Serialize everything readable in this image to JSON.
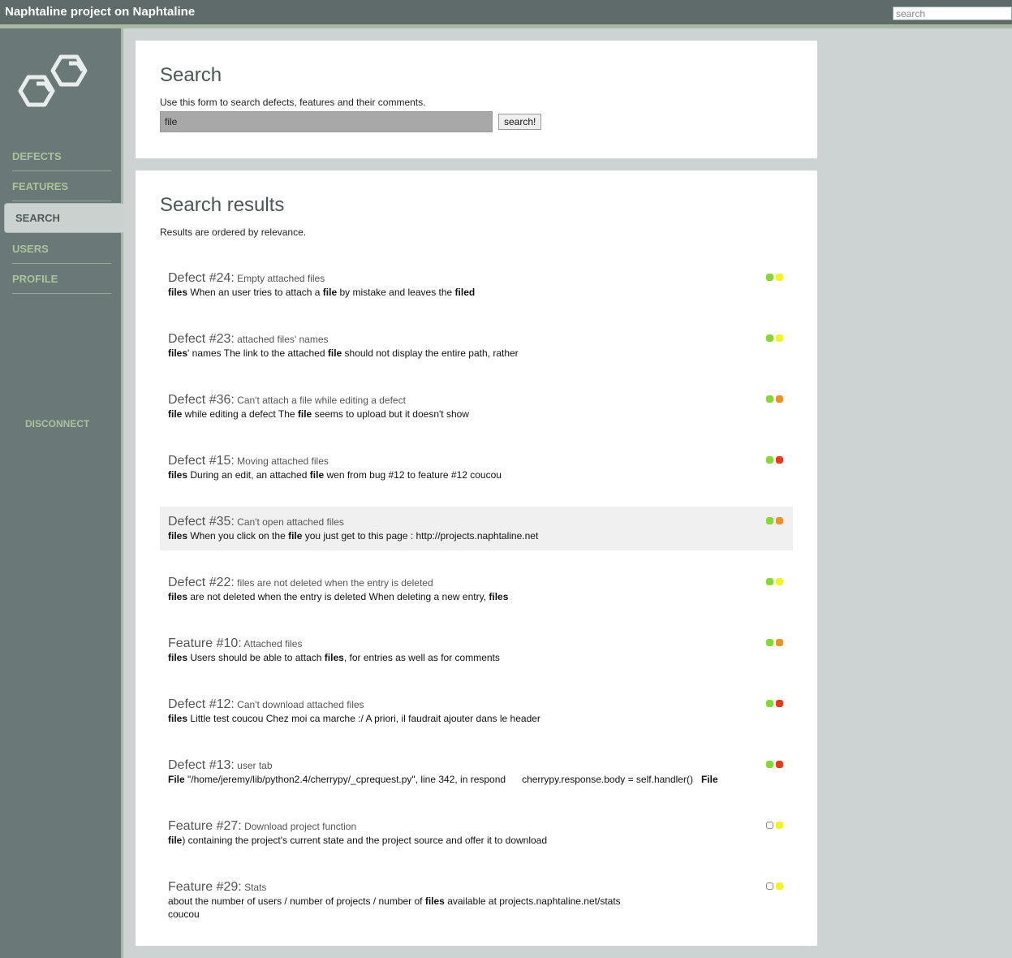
{
  "app": {
    "title": "Naphtaline project on Naphtaline",
    "search_placeholder": "search"
  },
  "sidebar": {
    "items": [
      {
        "label": "DEFECTS"
      },
      {
        "label": "FEATURES"
      },
      {
        "label": "SEARCH",
        "active": true
      },
      {
        "label": "USERS"
      },
      {
        "label": "PROFILE"
      }
    ],
    "disconnect": "DISCONNECT"
  },
  "search_panel": {
    "heading": "Search",
    "description": "Use this form to search defects, features and their comments.",
    "query": "file",
    "button": "search!"
  },
  "results_panel": {
    "heading": "Search results",
    "description": "Results are ordered by relevance.",
    "results": [
      {
        "kind": "Defect #24:",
        "name": "Empty attached files",
        "snippet": [
          [
            "b",
            "files"
          ],
          [
            "t",
            " When an user tries to attach a "
          ],
          [
            "b",
            "file"
          ],
          [
            "t",
            " by mistake and leaves the "
          ],
          [
            "b",
            "filed"
          ]
        ],
        "status": [
          "green",
          "yellow"
        ]
      },
      {
        "kind": "Defect #23:",
        "name": "attached files' names",
        "snippet": [
          [
            "b",
            "files"
          ],
          [
            "t",
            "' names The link to the attached "
          ],
          [
            "b",
            "file"
          ],
          [
            "t",
            " should not display the entire path, rather"
          ]
        ],
        "status": [
          "green",
          "yellow"
        ]
      },
      {
        "kind": "Defect #36:",
        "name": "Can't attach a file while editing a defect",
        "snippet": [
          [
            "b",
            "file"
          ],
          [
            "t",
            " while editing a defect The "
          ],
          [
            "b",
            "file"
          ],
          [
            "t",
            " seems to upload but it doesn't show"
          ]
        ],
        "status": [
          "green",
          "orange"
        ]
      },
      {
        "kind": "Defect #15:",
        "name": "Moving attached files",
        "snippet": [
          [
            "b",
            "files"
          ],
          [
            "t",
            " During an edit, an attached "
          ],
          [
            "b",
            "file"
          ],
          [
            "t",
            " wen from bug #12 to feature #12 coucou"
          ]
        ],
        "status": [
          "green",
          "red"
        ]
      },
      {
        "kind": "Defect #35:",
        "name": "Can't open attached files",
        "snippet": [
          [
            "b",
            "files"
          ],
          [
            "t",
            " When you click on the "
          ],
          [
            "b",
            "file"
          ],
          [
            "t",
            " you just get to this page : http://projects.naphtaline.net"
          ]
        ],
        "status": [
          "green",
          "orange"
        ],
        "highlighted": true
      },
      {
        "kind": "Defect #22:",
        "name": "files are not deleted when the entry is deleted",
        "snippet": [
          [
            "b",
            "files"
          ],
          [
            "t",
            " are not deleted when the entry is deleted When deleting a new entry, "
          ],
          [
            "b",
            "files"
          ]
        ],
        "status": [
          "green",
          "yellow"
        ]
      },
      {
        "kind": "Feature #10:",
        "name": "Attached files",
        "snippet": [
          [
            "b",
            "files"
          ],
          [
            "t",
            " Users should be able to attach "
          ],
          [
            "b",
            "files"
          ],
          [
            "t",
            ", for entries as well as for comments"
          ]
        ],
        "status": [
          "green",
          "orange"
        ]
      },
      {
        "kind": "Defect #12:",
        "name": "Can't download attached files",
        "snippet": [
          [
            "b",
            "files"
          ],
          [
            "t",
            " Little test coucou Chez moi ca marche :/ A priori, il faudrait ajouter dans le header"
          ]
        ],
        "status": [
          "green",
          "red"
        ]
      },
      {
        "kind": "Defect #13:",
        "name": "user tab",
        "snippet": [
          [
            "b",
            "File"
          ],
          [
            "t",
            " \"/home/jeremy/lib/python2.4/cherrypy/_cprequest.py\", line 342, in respond      cherrypy.response.body = self.handler()   "
          ],
          [
            "b",
            "File"
          ]
        ],
        "status": [
          "green",
          "red"
        ]
      },
      {
        "kind": "Feature #27:",
        "name": "Download project function",
        "snippet": [
          [
            "b",
            "file"
          ],
          [
            "t",
            ") containing the project's current state and the project source and offer it to download"
          ]
        ],
        "status": [
          "empty",
          "yellow"
        ]
      },
      {
        "kind": "Feature #29:",
        "name": "Stats",
        "snippet": [
          [
            "t",
            "about the number of users / number of projects / number of "
          ],
          [
            "b",
            "files"
          ],
          [
            "t",
            " available at projects.naphtaline.net/stats\ncoucou"
          ]
        ],
        "status": [
          "empty",
          "yellow"
        ]
      }
    ]
  },
  "colors": {
    "green": "#88d63a",
    "yellow": "#f2f22a",
    "orange": "#ec922c",
    "red": "#e43a1e",
    "empty": "#ffffff"
  }
}
